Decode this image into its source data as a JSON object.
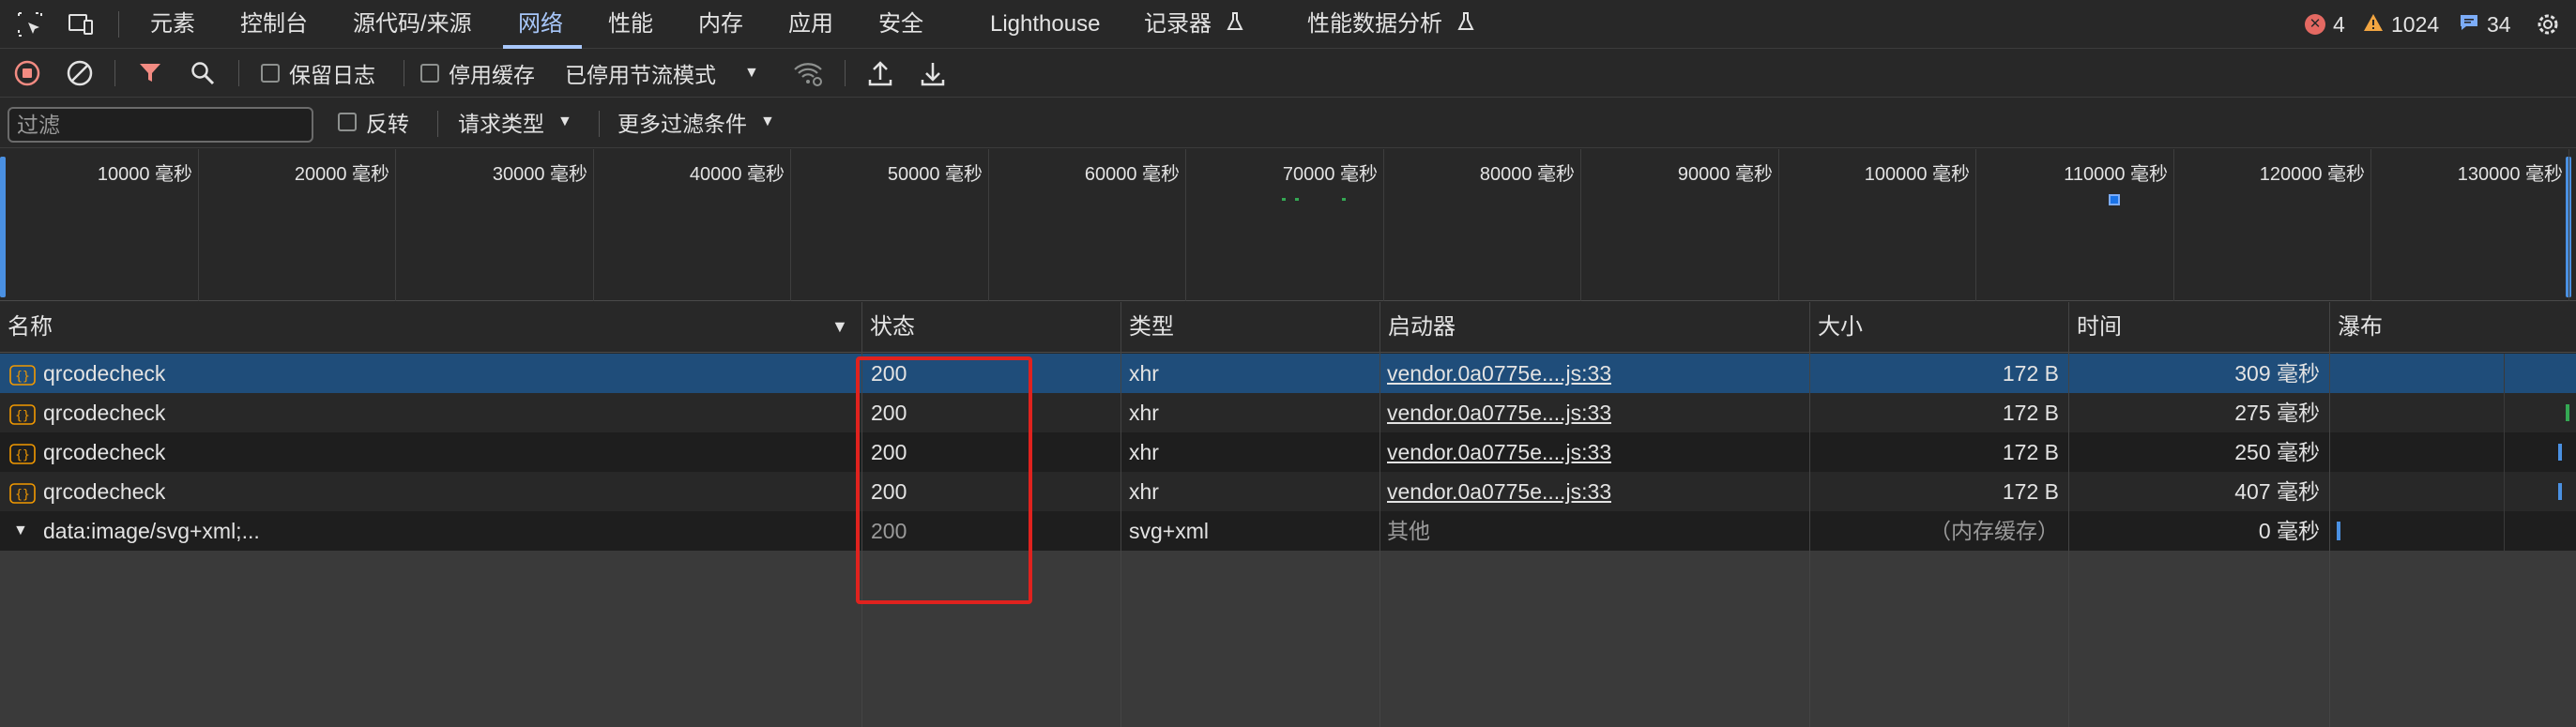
{
  "tabs": [
    {
      "label": "元素"
    },
    {
      "label": "控制台"
    },
    {
      "label": "源代码/来源"
    },
    {
      "label": "网络"
    },
    {
      "label": "性能"
    },
    {
      "label": "内存"
    },
    {
      "label": "应用"
    },
    {
      "label": "安全"
    },
    {
      "label": "Lighthouse"
    },
    {
      "label": "记录器"
    },
    {
      "label": "性能数据分析"
    }
  ],
  "active_tab": "网络",
  "counters": {
    "errors": "4",
    "warnings": "1024",
    "messages": "34"
  },
  "toolbar": {
    "preserve_log": "保留日志",
    "disable_cache": "停用缓存",
    "throttling": "已停用节流模式"
  },
  "filter": {
    "placeholder": "过滤",
    "invert": "反转",
    "request_type": "请求类型",
    "more_filters": "更多过滤条件"
  },
  "overview": {
    "ticks": [
      "10000 毫秒",
      "20000 毫秒",
      "30000 毫秒",
      "40000 毫秒",
      "50000 毫秒",
      "60000 毫秒",
      "70000 毫秒",
      "80000 毫秒",
      "90000 毫秒",
      "100000 毫秒",
      "110000 毫秒",
      "120000 毫秒",
      "130000 毫秒"
    ]
  },
  "table": {
    "headers": {
      "name": "名称",
      "status": "状态",
      "type": "类型",
      "initiator": "启动器",
      "size": "大小",
      "time": "时间",
      "waterfall": "瀑布"
    },
    "rows": [
      {
        "name": "qrcodecheck",
        "status": "200",
        "type": "xhr",
        "initiator": "vendor.0a0775e....js:33",
        "size": "172 B",
        "time": "309 毫秒"
      },
      {
        "name": "qrcodecheck",
        "status": "200",
        "type": "xhr",
        "initiator": "vendor.0a0775e....js:33",
        "size": "172 B",
        "time": "275 毫秒"
      },
      {
        "name": "qrcodecheck",
        "status": "200",
        "type": "xhr",
        "initiator": "vendor.0a0775e....js:33",
        "size": "172 B",
        "time": "250 毫秒"
      },
      {
        "name": "qrcodecheck",
        "status": "200",
        "type": "xhr",
        "initiator": "vendor.0a0775e....js:33",
        "size": "172 B",
        "time": "407 毫秒"
      },
      {
        "name": "data:image/svg+xml;...",
        "status": "200",
        "type": "svg+xml",
        "initiator": "其他",
        "size": "（内存缓存）",
        "time": "0 毫秒"
      }
    ]
  },
  "colors": {
    "accent": "#a8c7fa",
    "selected_row": "#1f4d7a",
    "annotation": "#e0221e",
    "error": "#e46962",
    "warning": "#f2a541",
    "filter_icon": "#f28b82",
    "record": "#f28b82"
  }
}
